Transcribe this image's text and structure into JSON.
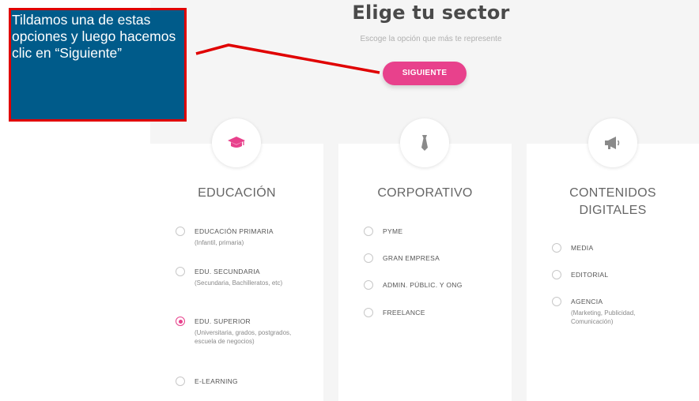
{
  "header": {
    "title": "Elige tu sector",
    "subtitle": "Escoge la opción que más te represente",
    "next_button": "SIGUIENTE"
  },
  "annotation": {
    "text": "Tildamos una de estas opciones y luego hacemos clic en “Siguiente”",
    "border_color": "#e00000",
    "background_color": "#005b8a"
  },
  "accent_color": "#e8418c",
  "cards": [
    {
      "title": "EDUCACIÓN",
      "icon": "graduation-cap-icon",
      "options": [
        {
          "label": "EDUCACIÓN PRIMARIA",
          "desc": "(Infantil, primaria)",
          "selected": false
        },
        {
          "label": "EDU. SECUNDARIA",
          "desc": "(Secundaria, Bachilleratos, etc)",
          "selected": false
        },
        {
          "label": "EDU. SUPERIOR",
          "desc": "(Universitaria, grados, postgrados, escuela de negocios)",
          "selected": true
        },
        {
          "label": "E-LEARNING",
          "desc": "",
          "selected": false
        }
      ]
    },
    {
      "title": "CORPORATIVO",
      "icon": "tie-icon",
      "options": [
        {
          "label": "PYME",
          "selected": false
        },
        {
          "label": "GRAN EMPRESA",
          "selected": false
        },
        {
          "label": "ADMIN. PÚBLIC. Y ONG",
          "selected": false
        },
        {
          "label": "FREELANCE",
          "selected": false
        }
      ]
    },
    {
      "title_line1": "CONTENIDOS",
      "title_line2": "DIGITALES",
      "icon": "megaphone-icon",
      "options": [
        {
          "label": "MEDIA",
          "selected": false
        },
        {
          "label": "EDITORIAL",
          "selected": false
        },
        {
          "label": "AGENCIA",
          "desc": "(Marketing, Publicidad, Comunicación)",
          "selected": false
        }
      ]
    }
  ]
}
